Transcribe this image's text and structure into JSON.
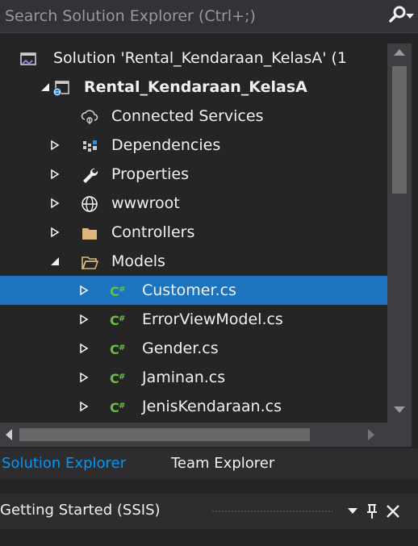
{
  "search": {
    "placeholder": "Search Solution Explorer (Ctrl+;)"
  },
  "tree": [
    {
      "label": "Solution 'Rental_Kendaraan_KelasA' (1",
      "icon": "solution-icon",
      "expander": "none",
      "bold": false,
      "selected": false
    },
    {
      "label": "Rental_Kendaraan_KelasA",
      "icon": "web-project-icon",
      "expander": "expanded",
      "bold": true,
      "selected": false
    },
    {
      "label": "Connected Services",
      "icon": "connected-services-icon",
      "expander": "none",
      "bold": false,
      "selected": false
    },
    {
      "label": "Dependencies",
      "icon": "dependencies-icon",
      "expander": "collapsed",
      "bold": false,
      "selected": false
    },
    {
      "label": "Properties",
      "icon": "wrench-icon",
      "expander": "collapsed",
      "bold": false,
      "selected": false
    },
    {
      "label": "wwwroot",
      "icon": "globe-icon",
      "expander": "collapsed",
      "bold": false,
      "selected": false
    },
    {
      "label": "Controllers",
      "icon": "folder-icon",
      "expander": "collapsed",
      "bold": false,
      "selected": false
    },
    {
      "label": "Models",
      "icon": "folder-open-icon",
      "expander": "expanded",
      "bold": false,
      "selected": false
    },
    {
      "label": "Customer.cs",
      "icon": "csharp-file-icon",
      "expander": "collapsed",
      "bold": false,
      "selected": true
    },
    {
      "label": "ErrorViewModel.cs",
      "icon": "csharp-file-icon",
      "expander": "collapsed",
      "bold": false,
      "selected": false
    },
    {
      "label": "Gender.cs",
      "icon": "csharp-file-icon",
      "expander": "collapsed",
      "bold": false,
      "selected": false
    },
    {
      "label": "Jaminan.cs",
      "icon": "csharp-file-icon",
      "expander": "collapsed",
      "bold": false,
      "selected": false
    },
    {
      "label": "JenisKendaraan.cs",
      "icon": "csharp-file-icon",
      "expander": "collapsed",
      "bold": false,
      "selected": false
    }
  ],
  "tabs": {
    "solution_explorer": "Solution Explorer",
    "team_explorer": "Team Explorer"
  },
  "getting_started": {
    "title": "Getting Started (SSIS)"
  },
  "colors": {
    "background": "#252526",
    "selection": "#1c74bf",
    "active_tab_text": "#0097fb",
    "csharp_icon": "#68c040",
    "folder": "#dcb67a"
  }
}
